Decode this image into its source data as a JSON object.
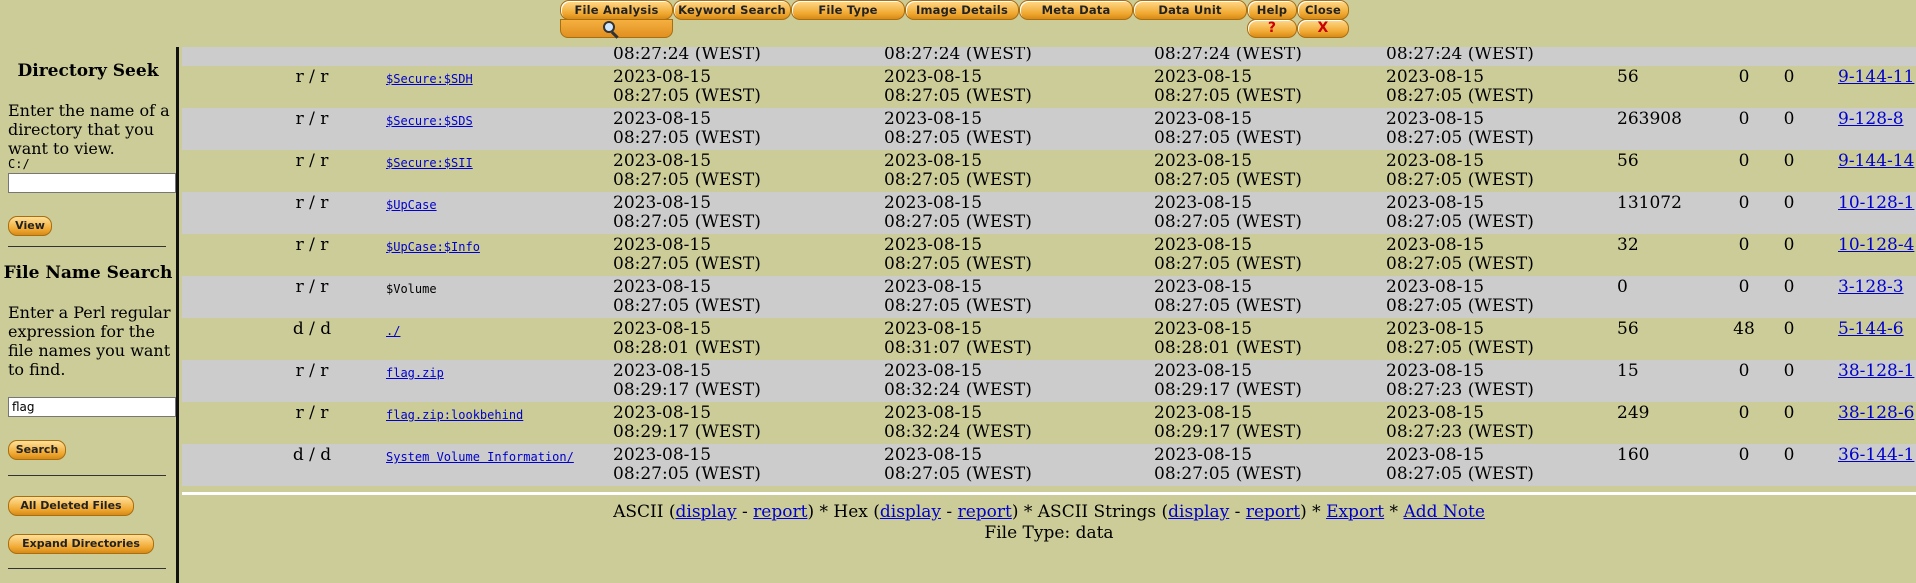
{
  "tabs": [
    {
      "label": "File Analysis"
    },
    {
      "label": "Keyword Search"
    },
    {
      "label": "File Type"
    },
    {
      "label": "Image Details"
    },
    {
      "label": "Meta Data"
    },
    {
      "label": "Data Unit"
    },
    {
      "label": "Help",
      "glyph": "?"
    },
    {
      "label": "Close",
      "glyph": "X"
    }
  ],
  "sidebar": {
    "dir_title": "Directory Seek",
    "dir_desc": "Enter the name of a directory that you want to view.",
    "dir_prefix": "C:/",
    "dir_value": "",
    "view_label": "View",
    "search_title": "File Name Search",
    "search_desc": "Enter a Perl regular expression for the file names you want to find.",
    "search_value": "flag",
    "search_label": "Search",
    "deleted_label": "All Deleted Files",
    "expand_label": "Expand Directories"
  },
  "partial_row": {
    "t1": "08:27:24  (WEST)",
    "t2": "08:27:24  (WEST)",
    "t3": "08:27:24  (WEST)",
    "t4": "08:27:24  (WEST)"
  },
  "rows": [
    {
      "type": "r / r",
      "name": "$Secure:$SDH",
      "linked": true,
      "t1d": "2023-08-15",
      "t1t": "08:27:05  (WEST)",
      "t2d": "2023-08-15",
      "t2t": "08:27:05  (WEST)",
      "t3d": "2023-08-15",
      "t3t": "08:27:05  (WEST)",
      "t4d": "2023-08-15",
      "t4t": "08:27:05  (WEST)",
      "size": "56",
      "uid": "0",
      "gid": "0",
      "meta": "9-144-11"
    },
    {
      "type": "r / r",
      "name": "$Secure:$SDS",
      "linked": true,
      "t1d": "2023-08-15",
      "t1t": "08:27:05  (WEST)",
      "t2d": "2023-08-15",
      "t2t": "08:27:05  (WEST)",
      "t3d": "2023-08-15",
      "t3t": "08:27:05  (WEST)",
      "t4d": "2023-08-15",
      "t4t": "08:27:05  (WEST)",
      "size": "263908",
      "uid": "0",
      "gid": "0",
      "meta": "9-128-8"
    },
    {
      "type": "r / r",
      "name": "$Secure:$SII",
      "linked": true,
      "t1d": "2023-08-15",
      "t1t": "08:27:05  (WEST)",
      "t2d": "2023-08-15",
      "t2t": "08:27:05  (WEST)",
      "t3d": "2023-08-15",
      "t3t": "08:27:05  (WEST)",
      "t4d": "2023-08-15",
      "t4t": "08:27:05  (WEST)",
      "size": "56",
      "uid": "0",
      "gid": "0",
      "meta": "9-144-14"
    },
    {
      "type": "r / r",
      "name": "$UpCase",
      "linked": true,
      "t1d": "2023-08-15",
      "t1t": "08:27:05  (WEST)",
      "t2d": "2023-08-15",
      "t2t": "08:27:05  (WEST)",
      "t3d": "2023-08-15",
      "t3t": "08:27:05  (WEST)",
      "t4d": "2023-08-15",
      "t4t": "08:27:05  (WEST)",
      "size": "131072",
      "uid": "0",
      "gid": "0",
      "meta": "10-128-1"
    },
    {
      "type": "r / r",
      "name": "$UpCase:$Info",
      "linked": true,
      "t1d": "2023-08-15",
      "t1t": "08:27:05  (WEST)",
      "t2d": "2023-08-15",
      "t2t": "08:27:05  (WEST)",
      "t3d": "2023-08-15",
      "t3t": "08:27:05  (WEST)",
      "t4d": "2023-08-15",
      "t4t": "08:27:05  (WEST)",
      "size": "32",
      "uid": "0",
      "gid": "0",
      "meta": "10-128-4"
    },
    {
      "type": "r / r",
      "name": "$Volume",
      "linked": false,
      "t1d": "2023-08-15",
      "t1t": "08:27:05  (WEST)",
      "t2d": "2023-08-15",
      "t2t": "08:27:05  (WEST)",
      "t3d": "2023-08-15",
      "t3t": "08:27:05  (WEST)",
      "t4d": "2023-08-15",
      "t4t": "08:27:05  (WEST)",
      "size": "0",
      "uid": "0",
      "gid": "0",
      "meta": "3-128-3"
    },
    {
      "type": "d / d",
      "name": "./",
      "linked": true,
      "t1d": "2023-08-15",
      "t1t": "08:28:01  (WEST)",
      "t2d": "2023-08-15",
      "t2t": "08:31:07  (WEST)",
      "t3d": "2023-08-15",
      "t3t": "08:28:01  (WEST)",
      "t4d": "2023-08-15",
      "t4t": "08:27:05  (WEST)",
      "size": "56",
      "uid": "48",
      "gid": "0",
      "meta": "5-144-6"
    },
    {
      "type": "r / r",
      "name": "flag.zip",
      "linked": true,
      "t1d": "2023-08-15",
      "t1t": "08:29:17  (WEST)",
      "t2d": "2023-08-15",
      "t2t": "08:32:24  (WEST)",
      "t3d": "2023-08-15",
      "t3t": "08:29:17  (WEST)",
      "t4d": "2023-08-15",
      "t4t": "08:27:23  (WEST)",
      "size": "15",
      "uid": "0",
      "gid": "0",
      "meta": "38-128-1"
    },
    {
      "type": "r / r",
      "name": "flag.zip:lookbehind",
      "linked": true,
      "t1d": "2023-08-15",
      "t1t": "08:29:17  (WEST)",
      "t2d": "2023-08-15",
      "t2t": "08:32:24  (WEST)",
      "t3d": "2023-08-15",
      "t3t": "08:29:17  (WEST)",
      "t4d": "2023-08-15",
      "t4t": "08:27:23  (WEST)",
      "size": "249",
      "uid": "0",
      "gid": "0",
      "meta": "38-128-6"
    },
    {
      "type": "d / d",
      "name": "System Volume Information/",
      "linked": true,
      "t1d": "2023-08-15",
      "t1t": "08:27:05  (WEST)",
      "t2d": "2023-08-15",
      "t2t": "08:27:05  (WEST)",
      "t3d": "2023-08-15",
      "t3t": "08:27:05  (WEST)",
      "t4d": "2023-08-15",
      "t4t": "08:27:05  (WEST)",
      "size": "160",
      "uid": "0",
      "gid": "0",
      "meta": "36-144-1"
    }
  ],
  "footer": {
    "ascii": "ASCII (",
    "display": "display",
    "dash": " - ",
    "report": "report",
    "hex": ") * Hex (",
    "strings": ") * ASCII Strings (",
    "sep": ") * ",
    "export": "Export",
    "star": " * ",
    "add_note": "Add Note",
    "file_type": "File Type: data"
  }
}
